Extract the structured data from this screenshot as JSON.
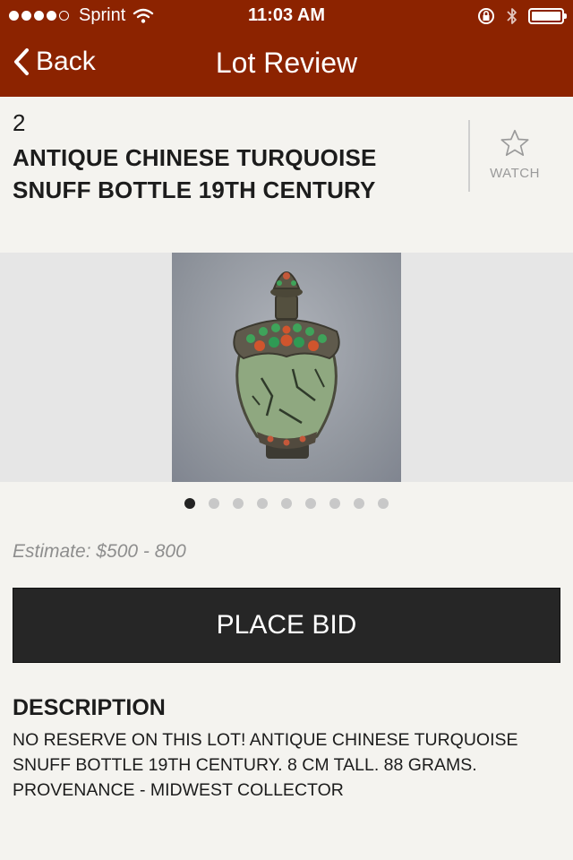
{
  "status_bar": {
    "carrier": "Sprint",
    "time": "11:03 AM",
    "signal_bars_filled": 4,
    "signal_bars_total": 5,
    "battery_level": 1.0
  },
  "nav": {
    "back_label": "Back",
    "title": "Lot Review"
  },
  "lot": {
    "number": "2",
    "title": "ANTIQUE CHINESE TURQUOISE SNUFF BOTTLE 19TH CENTURY",
    "watch_label": "WATCH"
  },
  "gallery": {
    "image_count": 9,
    "active_index": 0
  },
  "estimate": "Estimate: $500 - 800",
  "place_bid_label": "PLACE BID",
  "description": {
    "heading": "DESCRIPTION",
    "text": "NO RESERVE ON THIS LOT! ANTIQUE CHINESE TURQUOISE SNUFF BOTTLE 19TH CENTURY.  8 CM TALL.  88 GRAMS. PROVENANCE - MIDWEST COLLECTOR"
  },
  "colors": {
    "header": "#8c2300",
    "button": "#262626",
    "background": "#f4f3ef"
  }
}
